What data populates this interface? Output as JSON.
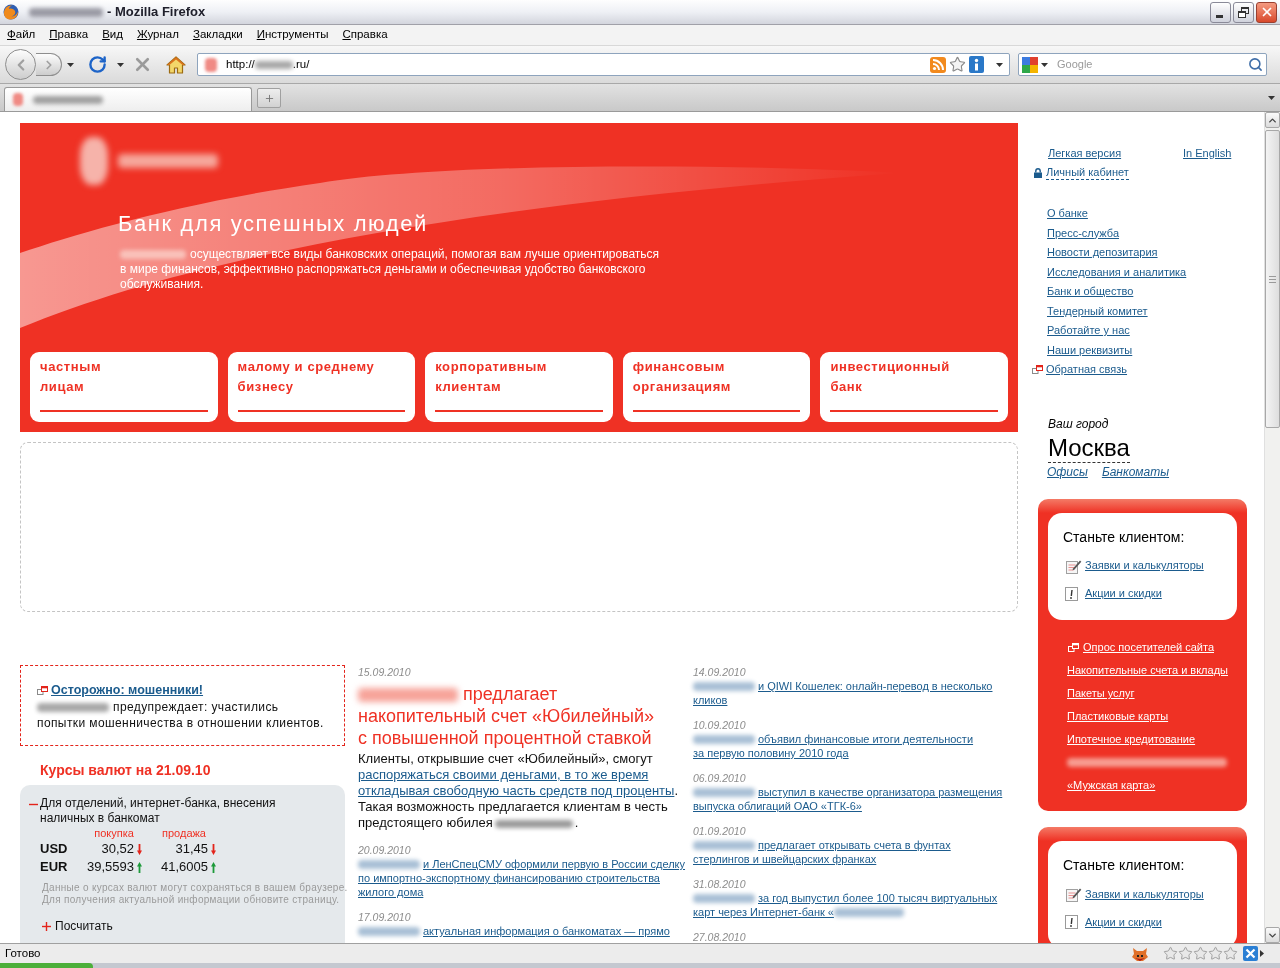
{
  "window": {
    "title": "- Mozilla Firefox"
  },
  "menu": [
    "Файл",
    "Правка",
    "Вид",
    "Журнал",
    "Закладки",
    "Инструменты",
    "Справка"
  ],
  "address_bar": {
    "prefix": "http://",
    "suffix": ".ru/"
  },
  "search": {
    "placeholder": "Google"
  },
  "tabs": [
    {
      "selected": true
    }
  ],
  "hero": {
    "heading": "Банк для успешных людей",
    "blur_before": true,
    "text_lines": [
      "осуществляет все виды банковских операций, помогая вам лучше ориентироваться",
      "в мире финансов, эффективно распоряжаться деньгами и обеспечивая удобство банковского",
      "обслуживания."
    ],
    "cards": [
      {
        "lines": [
          "частным",
          "лицам"
        ]
      },
      {
        "lines": [
          "малому и среднему",
          "бизнесу"
        ]
      },
      {
        "lines": [
          "корпоративным",
          "клиентам"
        ]
      },
      {
        "lines": [
          "финансовым",
          "организациям"
        ]
      },
      {
        "lines": [
          "инвестиционный",
          "банк"
        ]
      }
    ]
  },
  "alert": {
    "title": "Осторожно: мошенники!",
    "blur_before": true,
    "text_lines": [
      "предупреждает: участились",
      "попытки мошенничества в отношении клиентов."
    ]
  },
  "rates": {
    "title": "Курсы валют на 21.09.10",
    "section": {
      "title_lines": [
        "Для отделений, интернет-банка, внесения",
        "наличных в банкомат"
      ],
      "expanded": true
    },
    "columns": [
      "покупка",
      "продажа"
    ],
    "rows": [
      {
        "currency": "USD",
        "buy": "30,52",
        "buy_rising": false,
        "sell": "31,45",
        "sell_rising": false
      },
      {
        "currency": "EUR",
        "buy": "39,5593",
        "buy_rising": true,
        "sell": "41,6005",
        "sell_rising": true
      }
    ],
    "note_lines": [
      "Данные о курсах валют могут сохраняться в вашем браузере.",
      "Для получения актуальной информации обновите страницу."
    ],
    "calculator": {
      "label": "Посчитать",
      "expanded": false
    }
  },
  "lead_news": {
    "date": "15.09.2010",
    "blur_before": true,
    "title_lines": [
      "предлагает",
      "накопительный счет «Юбилейный»",
      "с повышенной процентной ставкой"
    ],
    "body_lines": [
      [
        {
          "kind": "text",
          "text": "Клиенты, открывшие счет «Юбилейный», смогут"
        }
      ],
      [
        {
          "kind": "link",
          "text": "распоряжаться своими деньгами, в то же время"
        }
      ],
      [
        {
          "kind": "link",
          "text": "откладывая свободную часть средств под проценты"
        },
        {
          "kind": "text",
          "text": "."
        }
      ],
      [
        {
          "kind": "text",
          "text": "Такая возможность предлагается клиентам в честь"
        }
      ],
      [
        {
          "kind": "text",
          "text": "предстоящего юбилея"
        },
        {
          "kind": "blur"
        },
        {
          "kind": "text",
          "text": "."
        }
      ]
    ]
  },
  "news_middle": [
    {
      "date": "20.09.2010",
      "blur_before": true,
      "lines": [
        "и ЛенСпецСМУ оформили первую в России сделку",
        "по импортно-экспортному финансированию строительства",
        "жилого дома"
      ]
    },
    {
      "date": "17.09.2010",
      "blur_before": true,
      "lines": [
        "актуальная информация о банкоматах — прямо"
      ]
    }
  ],
  "news_right": [
    {
      "date": "14.09.2010",
      "blur_before": true,
      "lines": [
        "и QIWI Кошелек: онлайн-перевод в несколько",
        "кликов"
      ]
    },
    {
      "date": "10.09.2010",
      "blur_before": true,
      "lines": [
        "объявил финансовые итоги деятельности",
        "за первую половину 2010 года"
      ]
    },
    {
      "date": "06.09.2010",
      "blur_before": true,
      "lines": [
        "выступил в качестве организатора размещения",
        "выпуска облигаций ОАО «ТГК-6»"
      ]
    },
    {
      "date": "01.09.2010",
      "blur_before": true,
      "lines": [
        "предлагает открывать счета в фунтах",
        "стерлингов и швейцарских франках"
      ]
    },
    {
      "date": "31.08.2010",
      "blur_before": true,
      "blur_after": true,
      "lines": [
        "за год выпустил более 100 тысяч виртуальных",
        "карт через Интернет-банк «"
      ]
    },
    {
      "date": "27.08.2010"
    }
  ],
  "sidebar": {
    "top_links": [
      "Легкая версия",
      "In English"
    ],
    "cabinet": "Личный кабинет",
    "nav": [
      {
        "kind": "plain",
        "text": "О банке"
      },
      {
        "kind": "plain",
        "text": "Пресс-служба"
      },
      {
        "kind": "plain",
        "text": "Новости депозитария"
      },
      {
        "kind": "plain",
        "text": "Исследования и аналитика"
      },
      {
        "kind": "plain",
        "text": "Банк и общество"
      },
      {
        "kind": "plain",
        "text": "Тендерный комитет"
      },
      {
        "kind": "plain",
        "text": "Работайте у нас"
      },
      {
        "kind": "plain",
        "text": "Наши реквизиты"
      },
      {
        "kind": "popup",
        "text": "Обратная связь"
      }
    ],
    "city": {
      "label": "Ваш город",
      "name": "Москва",
      "links": [
        "Офисы",
        "Банкоматы"
      ]
    },
    "promo_cards": [
      {
        "title": "Станьте клиентом:",
        "links": [
          {
            "kind": "form",
            "text": "Заявки и калькуляторы"
          },
          {
            "kind": "notice",
            "text": "Акции и скидки"
          }
        ],
        "extra_links": [
          {
            "kind": "popup",
            "text": "Опрос посетителей сайта"
          },
          {
            "kind": "plain",
            "text": "Накопительные счета и вклады"
          },
          {
            "kind": "plain",
            "text": "Пакеты услуг"
          },
          {
            "kind": "plain",
            "text": "Пластиковые карты"
          },
          {
            "kind": "plain",
            "text": "Ипотечное кредитование"
          },
          {
            "kind": "blurred"
          },
          {
            "kind": "plain",
            "text": "«Мужская карта»"
          }
        ]
      },
      {
        "title": "Станьте клиентом:",
        "links": [
          {
            "kind": "form",
            "text": "Заявки и калькуляторы"
          },
          {
            "kind": "notice",
            "text": "Акции и скидки"
          }
        ]
      }
    ]
  },
  "status_bar": {
    "text": "Готово",
    "rating": {
      "stars": 0
    }
  }
}
